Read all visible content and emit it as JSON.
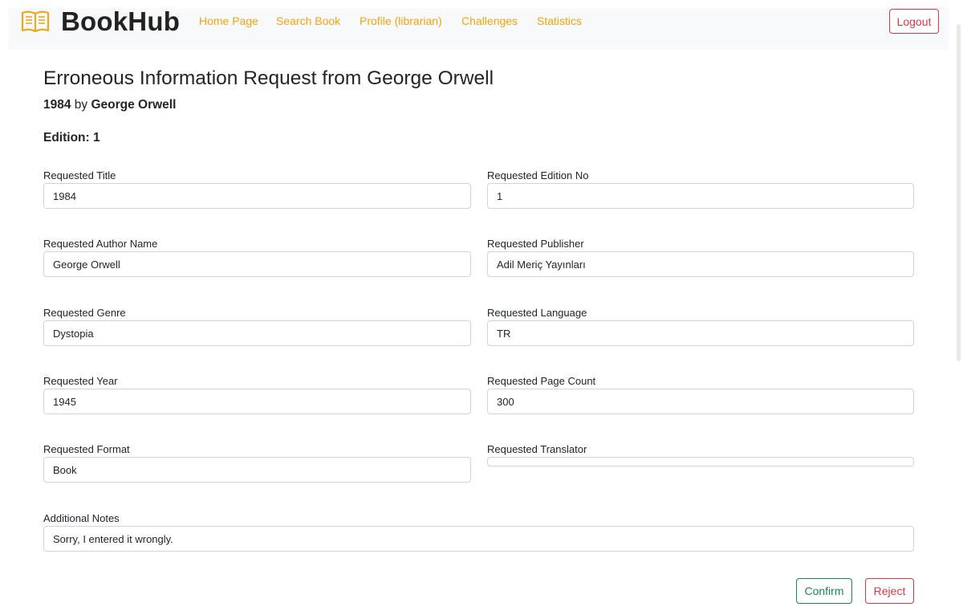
{
  "app": {
    "brand_name": "BookHub",
    "brand_icon": "open-book-icon",
    "accent_color": "#f5a30c"
  },
  "nav": {
    "items": [
      {
        "label": "Home Page"
      },
      {
        "label": "Search Book"
      },
      {
        "label": "Profile (librarian)"
      },
      {
        "label": "Challenges"
      },
      {
        "label": "Statistics"
      }
    ],
    "logout_label": "Logout"
  },
  "page": {
    "title": "Erroneous Information Request from George Orwell",
    "book_title": "1984",
    "by_text": " by ",
    "author": "George Orwell",
    "edition_label": "Edition:",
    "edition_value": "1"
  },
  "fields": {
    "title": {
      "label": "Requested Title",
      "value": "1984"
    },
    "edition_no": {
      "label": "Requested Edition No",
      "value": "1"
    },
    "author": {
      "label": "Requested Author Name",
      "value": "George Orwell"
    },
    "publisher": {
      "label": "Requested Publisher",
      "value": "Adil Meriç Yayınları"
    },
    "genre": {
      "label": "Requested Genre",
      "value": "Dystopia"
    },
    "language": {
      "label": "Requested Language",
      "value": "TR"
    },
    "year": {
      "label": "Requested Year",
      "value": "1945"
    },
    "page_count": {
      "label": "Requested Page Count",
      "value": "300"
    },
    "format": {
      "label": "Requested Format",
      "value": "Book"
    },
    "translator": {
      "label": "Requested Translator",
      "value": ""
    },
    "notes": {
      "label": "Additional Notes",
      "value": "Sorry, I entered it wrongly."
    }
  },
  "actions": {
    "confirm_label": "Confirm",
    "reject_label": "Reject",
    "confirm_color": "#198754",
    "reject_color": "#dc3545"
  }
}
